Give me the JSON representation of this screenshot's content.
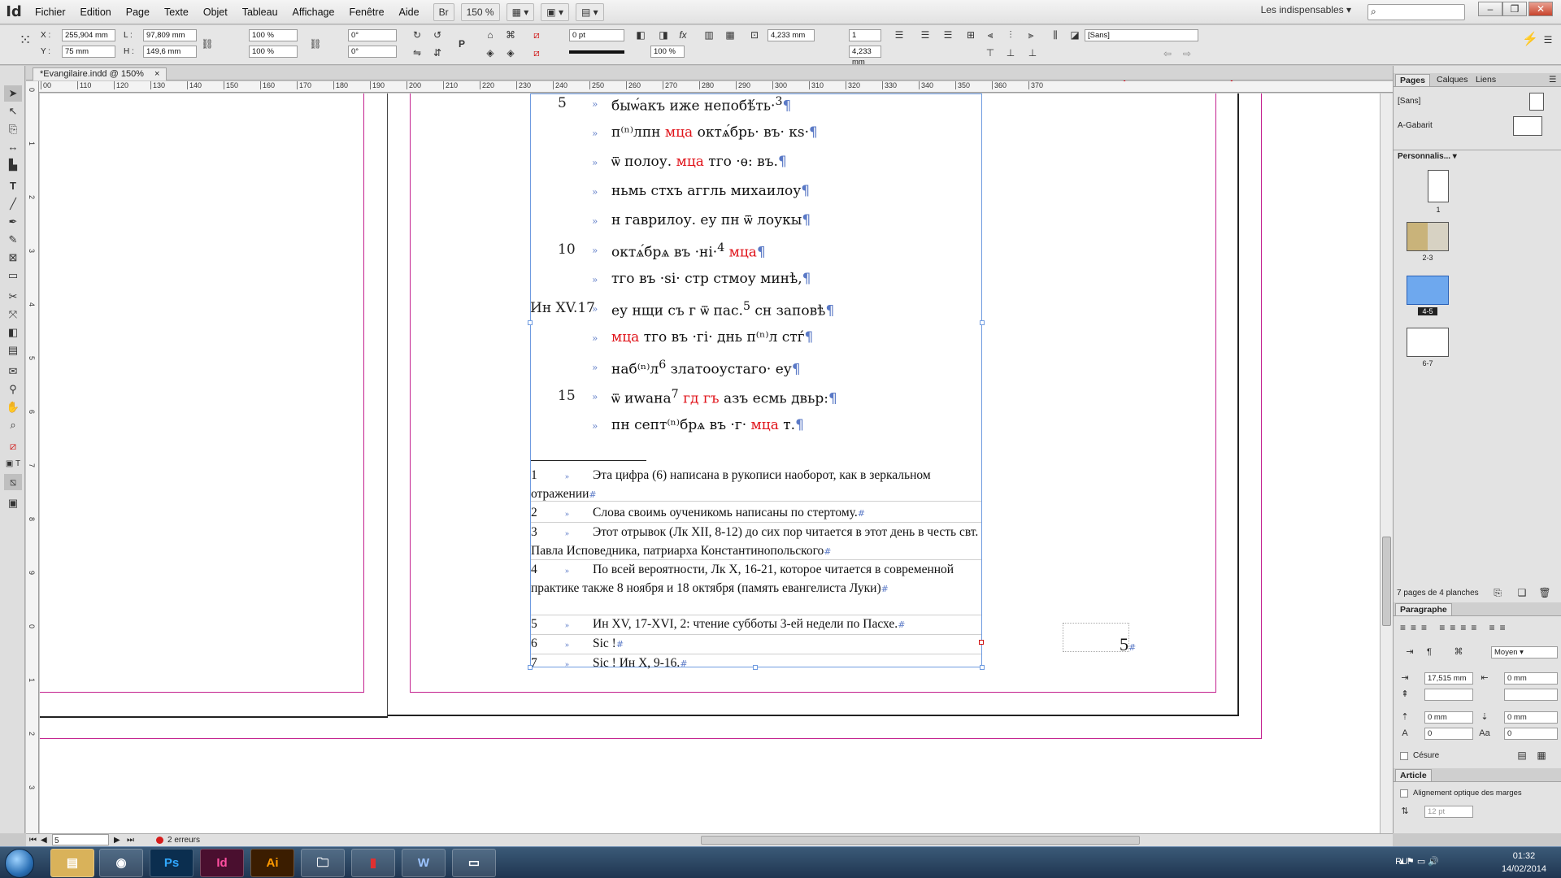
{
  "app": {
    "logo": "Id",
    "window_title": "*Evangilaire.indd @ 150%",
    "zoom": "150 %",
    "workspace": "Les indispensables",
    "bridge_button": "Br"
  },
  "menu": [
    "Fichier",
    "Edition",
    "Page",
    "Texte",
    "Objet",
    "Tableau",
    "Affichage",
    "Fenêtre",
    "Aide"
  ],
  "control": {
    "x_label": "X :",
    "x_value": "255,904 mm",
    "y_label": "Y :",
    "y_value": "75 mm",
    "w_label": "L :",
    "w_value": "97,809 mm",
    "h_label": "H :",
    "h_value": "149,6 mm",
    "scale_x": "100 %",
    "scale_y": "100 %",
    "rotate": "0°",
    "shear": "0°",
    "stroke_weight": "0 pt",
    "gutter_1": "4,233 mm",
    "gutter_2": "4,233 mm",
    "columns": "1",
    "opacity": "100 %",
    "object_style": "[Sans]"
  },
  "ruler": [
    "00",
    "110",
    "120",
    "130",
    "140",
    "150",
    "160",
    "170",
    "180",
    "190",
    "200",
    "210",
    "220",
    "230",
    "240",
    "250",
    "260",
    "270",
    "280",
    "290",
    "300",
    "310",
    "320",
    "330",
    "340",
    "350",
    "360",
    "370"
  ],
  "ruler_v": [
    "0",
    "1",
    "2",
    "3",
    "4",
    "5",
    "6",
    "7",
    "8",
    "9",
    "0",
    "1",
    "2",
    "3"
  ],
  "document": {
    "lines": [
      {
        "num": "5",
        "tab": "»",
        "text": "быѡ́акъ иже непобѣ́ть·",
        "sup": "3",
        "red": ""
      },
      {
        "num": "",
        "tab": "»",
        "text": "п⁽ⁿ⁾лпн",
        "red": "мца",
        "tail": "октѧ́брь· въ· кѕ·"
      },
      {
        "num": "",
        "tab": "»",
        "text": "ѿ полоу.",
        "red": "мца",
        "tail": "тго ·ѳ: въ."
      },
      {
        "num": "",
        "tab": "»",
        "text": "ньмь стхъ аггль михаилоу",
        "red": "",
        "tail": ""
      },
      {
        "num": "",
        "tab": "»",
        "text": "н гаврилоу. еу пн ѿ лоукы",
        "red": "",
        "tail": ""
      },
      {
        "num": "10",
        "tab": "»",
        "text": "октѧ́брѧ въ ·ні·",
        "sup": "4",
        "red": "мца"
      },
      {
        "num": "",
        "tab": "»",
        "text": "тго въ ·ѕі· стр стмоу минѣ,",
        "red": "",
        "tail": ""
      },
      {
        "num": "",
        "tab": "»",
        "ref": "Ин XV.17",
        "text": "еу нщи съ г ѿ пас.",
        "sup": "5",
        "tail": "сн заповѣ"
      },
      {
        "num": "",
        "tab": "»",
        "text": "",
        "red": "мца",
        "tail": "тго въ ·гі· днь п⁽ⁿ⁾л стѓ"
      },
      {
        "num": "",
        "tab": "»",
        "text": "наб⁽ⁿ⁾л",
        "sup": "6",
        "tail": "златооустаго· еу"
      },
      {
        "num": "15",
        "tab": "»",
        "text": "ѿ иwана",
        "sup": "7",
        "red": "гд гъ",
        "tail": "азъ есмь двьр:"
      },
      {
        "num": "",
        "tab": "»",
        "text": "пн септ⁽ⁿ⁾брѧ въ ·г·",
        "red": "мца",
        "tail": "т."
      }
    ],
    "footnotes": [
      {
        "num": "1",
        "text": "Эта цифра (6) написана в рукописи наоборот, как в зеркальном отражении"
      },
      {
        "num": "2",
        "text": "Слова своимь оученикомь написаны по стертому."
      },
      {
        "num": "3",
        "text": "Этот отрывок (Лк XII, 8-12) до сих пор читается в этот день в честь свт. Павла Исповедника, патриарха Константинопольского"
      },
      {
        "num": "4",
        "text": "По всей вероятности, Лк X, 16-21, которое читается в современной практике также 8 ноября и 18 октября (память евангелиста Луки)"
      },
      {
        "num": "5",
        "text": "Ин XV, 17-XVI, 2: чтение субботы 3-ей недели по Пасхе."
      },
      {
        "num": "6",
        "text": "Sic !"
      },
      {
        "num": "7",
        "text": "Sic ! Ин X, 9-16."
      }
    ],
    "page_number": "5"
  },
  "panels": {
    "tabs": [
      "Pages",
      "Calques",
      "Liens"
    ],
    "masters": [
      "[Sans]",
      "A-Gabarit"
    ],
    "personnalise": "Personnalis...",
    "page_labels": [
      "1",
      "2-3",
      "4-5",
      "6-7"
    ],
    "pages_summary": "7 pages de 4 planches",
    "paragraph_title": "Paragraphe",
    "para_values": {
      "left_indent": "17,515 mm",
      "right_indent": "0 mm",
      "space_before": "0 mm",
      "space_after": "0 mm",
      "drop_lines": "0",
      "drop_chars": "0",
      "moyen": "Moyen",
      "cesure": "Césure"
    },
    "article_title": "Article",
    "article_option": "Alignement optique des marges",
    "article_size": "12 pt"
  },
  "status": {
    "page": "5",
    "errors": "2 erreurs"
  },
  "taskbar": {
    "lang": "RU",
    "time": "01:32",
    "date": "14/02/2014",
    "apps": [
      "Ps",
      "Id",
      "Ai"
    ]
  },
  "colors": {
    "frame": "#6f9be0",
    "margin": "#c4218f",
    "red_text": "#e0131a",
    "annotation": "#e60012"
  }
}
